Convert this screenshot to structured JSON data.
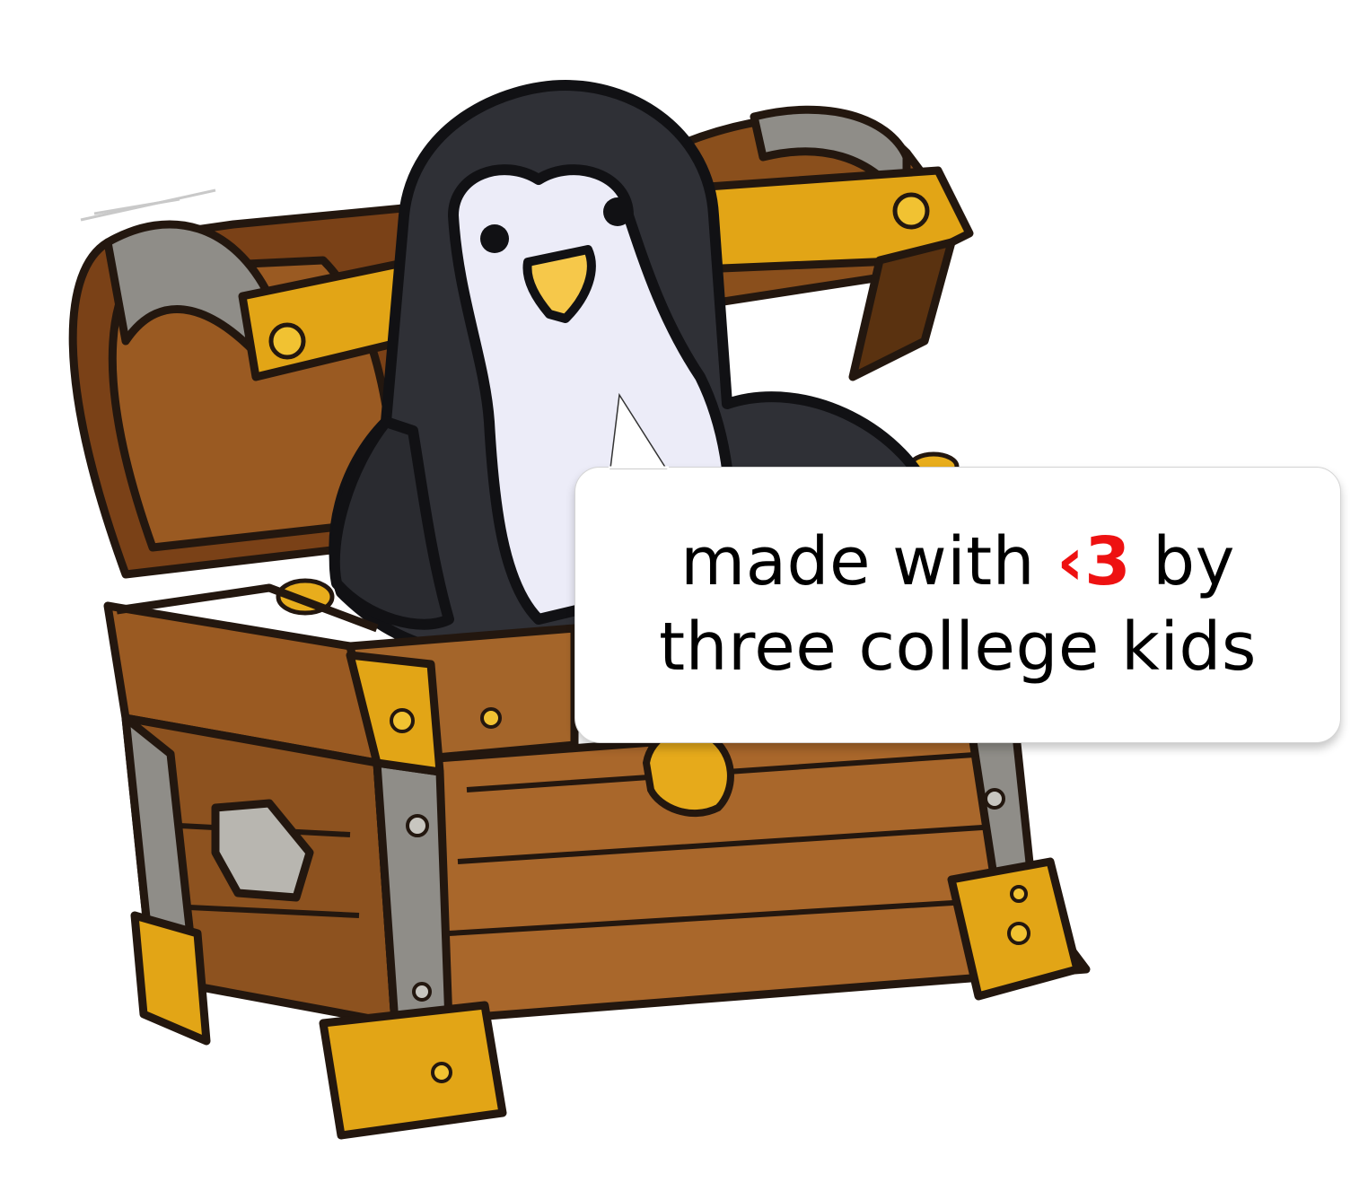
{
  "bubble": {
    "prefix": "made with",
    "heart": "‹3",
    "suffix": "by",
    "line2": "three college kids"
  },
  "colors": {
    "heart": "#ee1111",
    "wood": "#9a5a22",
    "gold": "#e2a516",
    "iron": "#8f8d88",
    "penguin_body": "#2f3036",
    "penguin_belly": "#ececf8",
    "beak": "#f6c84a"
  }
}
